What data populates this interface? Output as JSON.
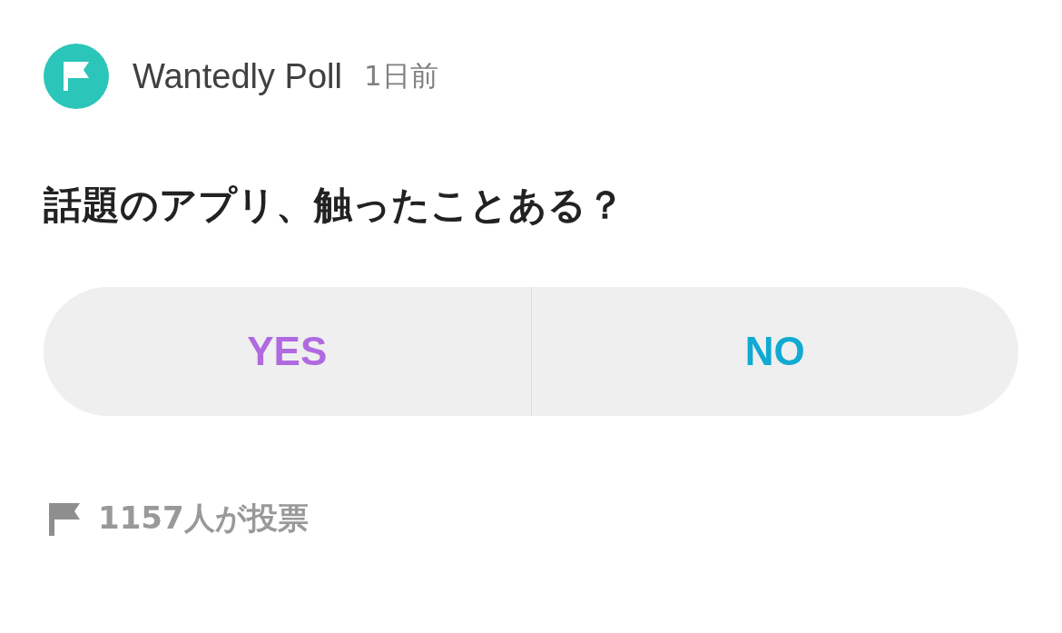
{
  "post": {
    "author": "Wantedly Poll",
    "time": "1日前"
  },
  "question": "話題のアプリ、触ったことある？",
  "options": [
    {
      "label": "YES",
      "color": "#b06ae0"
    },
    {
      "label": "NO",
      "color": "#10aad2"
    }
  ],
  "footer": {
    "votes": "1157人が投票"
  }
}
